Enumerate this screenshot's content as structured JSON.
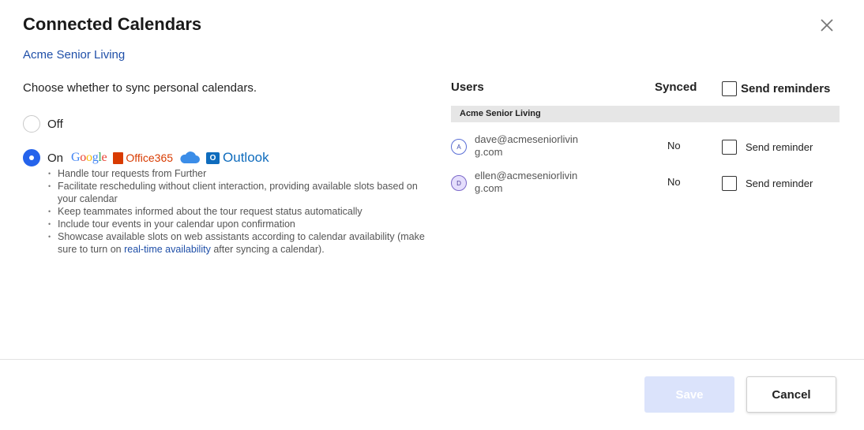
{
  "dialog": {
    "title": "Connected Calendars",
    "subtitle": "Acme Senior Living",
    "close_icon": "close-icon"
  },
  "sync": {
    "prompt": "Choose whether to sync personal calendars.",
    "options": [
      {
        "label": "Off",
        "selected": false
      },
      {
        "label": "On",
        "selected": true
      }
    ],
    "providers": {
      "google": "Google",
      "office": "Office365",
      "icloud_icon": "cloud-icon",
      "outlook": "Outlook"
    },
    "bullets": [
      "Handle tour requests from Further",
      "Facilitate rescheduling without client interaction, providing available slots based on your calendar",
      "Keep teammates informed about the tour request status automatically",
      "Include tour events in your calendar upon confirmation"
    ],
    "last_bullet": {
      "prefix": "Showcase available slots on web assistants according to calendar availability (make sure to turn on ",
      "link": "real-time availability",
      "suffix": " after syncing a calendar)."
    }
  },
  "table": {
    "headers": {
      "users": "Users",
      "synced": "Synced",
      "reminders": "Send reminders"
    },
    "group": "Acme Senior Living",
    "rows": [
      {
        "avatar": "A",
        "email_line1": "dave@acmeseniorlivin",
        "email_line2": "g.com",
        "synced": "No",
        "reminder_label": "Send reminder"
      },
      {
        "avatar": "D",
        "email_line1": "ellen@acmeseniorlivin",
        "email_line2": "g.com",
        "synced": "No",
        "reminder_label": "Send reminder"
      }
    ]
  },
  "footer": {
    "save": "Save",
    "cancel": "Cancel"
  },
  "colors": {
    "accent": "#2563eb",
    "link": "#1f4fa8",
    "save_disabled": "#dbe3fb"
  }
}
